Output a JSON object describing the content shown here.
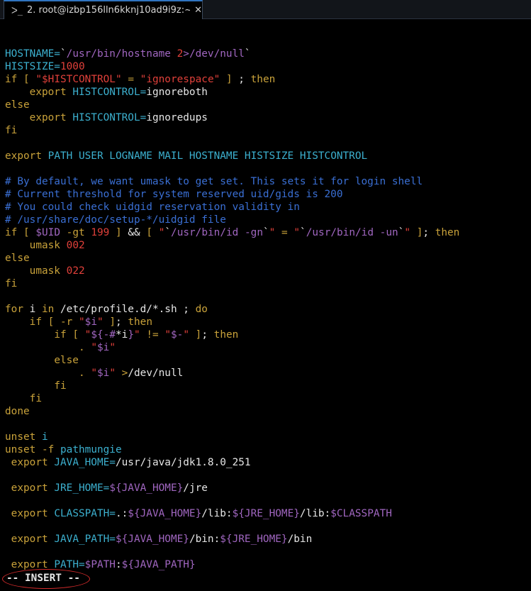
{
  "tab": {
    "icon": "terminal-icon",
    "icon_glyph": "ᐳ_",
    "title": "2. root@izbp156lln6kknj10ad9i9z:~",
    "close": "✕"
  },
  "lines": [
    [],
    [
      [
        "cy",
        "HOSTNAME="
      ],
      [
        "wh",
        "`"
      ],
      [
        "mg",
        "/usr/bin/hostname "
      ],
      [
        "rd",
        "2"
      ],
      [
        "mg",
        ">/dev/null"
      ],
      [
        "wh",
        "`"
      ]
    ],
    [
      [
        "cy",
        "HISTSIZE="
      ],
      [
        "rd",
        "1000"
      ]
    ],
    [
      [
        "ol",
        "if"
      ],
      [
        "wh",
        " "
      ],
      [
        "ol",
        "["
      ],
      [
        "wh",
        " "
      ],
      [
        "rd",
        "\"$HISTCONTROL\""
      ],
      [
        "wh",
        " "
      ],
      [
        "ol",
        "="
      ],
      [
        "wh",
        " "
      ],
      [
        "rd",
        "\"ignorespace\""
      ],
      [
        "wh",
        " "
      ],
      [
        "ol",
        "]"
      ],
      [
        "wh",
        " ; "
      ],
      [
        "ol",
        "then"
      ]
    ],
    [
      [
        "wh",
        "    "
      ],
      [
        "ol",
        "export"
      ],
      [
        "wh",
        " "
      ],
      [
        "cy",
        "HISTCONTROL="
      ],
      [
        "wh",
        "ignoreboth"
      ]
    ],
    [
      [
        "ol",
        "else"
      ]
    ],
    [
      [
        "wh",
        "    "
      ],
      [
        "ol",
        "export"
      ],
      [
        "wh",
        " "
      ],
      [
        "cy",
        "HISTCONTROL="
      ],
      [
        "wh",
        "ignoredups"
      ]
    ],
    [
      [
        "ol",
        "fi"
      ]
    ],
    [],
    [
      [
        "ol",
        "export"
      ],
      [
        "wh",
        " "
      ],
      [
        "cy",
        "PATH USER LOGNAME MAIL HOSTNAME HISTSIZE HISTCONTROL"
      ]
    ],
    [],
    [
      [
        "bl",
        "# By default, we want umask to get set. This sets it for login shell"
      ]
    ],
    [
      [
        "bl",
        "# Current threshold for system reserved uid/gids is 200"
      ]
    ],
    [
      [
        "bl",
        "# You could check uidgid reservation validity in"
      ]
    ],
    [
      [
        "bl",
        "# /usr/share/doc/setup-*/uidgid file"
      ]
    ],
    [
      [
        "ol",
        "if"
      ],
      [
        "wh",
        " "
      ],
      [
        "ol",
        "["
      ],
      [
        "wh",
        " "
      ],
      [
        "mg",
        "$UID"
      ],
      [
        "wh",
        " "
      ],
      [
        "ol",
        "-gt"
      ],
      [
        "wh",
        " "
      ],
      [
        "rd",
        "199"
      ],
      [
        "wh",
        " "
      ],
      [
        "ol",
        "]"
      ],
      [
        "wh",
        " && "
      ],
      [
        "ol",
        "["
      ],
      [
        "wh",
        " "
      ],
      [
        "rd",
        "\""
      ],
      [
        "wh",
        "`"
      ],
      [
        "mg",
        "/usr/bin/id -gn"
      ],
      [
        "wh",
        "`"
      ],
      [
        "rd",
        "\""
      ],
      [
        "wh",
        " "
      ],
      [
        "ol",
        "="
      ],
      [
        "wh",
        " "
      ],
      [
        "rd",
        "\""
      ],
      [
        "wh",
        "`"
      ],
      [
        "mg",
        "/usr/bin/id -un"
      ],
      [
        "wh",
        "`"
      ],
      [
        "rd",
        "\""
      ],
      [
        "wh",
        " "
      ],
      [
        "ol",
        "]"
      ],
      [
        "wh",
        "; "
      ],
      [
        "ol",
        "then"
      ]
    ],
    [
      [
        "wh",
        "    "
      ],
      [
        "ol",
        "umask"
      ],
      [
        "wh",
        " "
      ],
      [
        "rd",
        "002"
      ]
    ],
    [
      [
        "ol",
        "else"
      ]
    ],
    [
      [
        "wh",
        "    "
      ],
      [
        "ol",
        "umask"
      ],
      [
        "wh",
        " "
      ],
      [
        "rd",
        "022"
      ]
    ],
    [
      [
        "ol",
        "fi"
      ]
    ],
    [],
    [
      [
        "ol",
        "for"
      ],
      [
        "wh",
        " i "
      ],
      [
        "ol",
        "in"
      ],
      [
        "wh",
        " /etc/profile.d/*.sh ; "
      ],
      [
        "ol",
        "do"
      ]
    ],
    [
      [
        "wh",
        "    "
      ],
      [
        "ol",
        "if"
      ],
      [
        "wh",
        " "
      ],
      [
        "ol",
        "["
      ],
      [
        "wh",
        " "
      ],
      [
        "ol",
        "-r"
      ],
      [
        "wh",
        " "
      ],
      [
        "rd",
        "\""
      ],
      [
        "mg",
        "$i"
      ],
      [
        "rd",
        "\""
      ],
      [
        "wh",
        " "
      ],
      [
        "ol",
        "]"
      ],
      [
        "wh",
        "; "
      ],
      [
        "ol",
        "then"
      ]
    ],
    [
      [
        "wh",
        "        "
      ],
      [
        "ol",
        "if"
      ],
      [
        "wh",
        " "
      ],
      [
        "ol",
        "["
      ],
      [
        "wh",
        " "
      ],
      [
        "rd",
        "\""
      ],
      [
        "mg",
        "${-#"
      ],
      [
        "wh",
        "*i"
      ],
      [
        "mg",
        "}"
      ],
      [
        "rd",
        "\""
      ],
      [
        "wh",
        " "
      ],
      [
        "ol",
        "!="
      ],
      [
        "wh",
        " "
      ],
      [
        "rd",
        "\""
      ],
      [
        "mg",
        "$-"
      ],
      [
        "rd",
        "\""
      ],
      [
        "wh",
        " "
      ],
      [
        "ol",
        "]"
      ],
      [
        "wh",
        "; "
      ],
      [
        "ol",
        "then"
      ]
    ],
    [
      [
        "wh",
        "            "
      ],
      [
        "ol",
        "."
      ],
      [
        "wh",
        " "
      ],
      [
        "rd",
        "\""
      ],
      [
        "mg",
        "$i"
      ],
      [
        "rd",
        "\""
      ]
    ],
    [
      [
        "wh",
        "        "
      ],
      [
        "ol",
        "else"
      ]
    ],
    [
      [
        "wh",
        "            "
      ],
      [
        "ol",
        "."
      ],
      [
        "wh",
        " "
      ],
      [
        "rd",
        "\""
      ],
      [
        "mg",
        "$i"
      ],
      [
        "rd",
        "\""
      ],
      [
        "wh",
        " "
      ],
      [
        "ol",
        ">"
      ],
      [
        "wh",
        "/dev/null"
      ]
    ],
    [
      [
        "wh",
        "        "
      ],
      [
        "ol",
        "fi"
      ]
    ],
    [
      [
        "wh",
        "    "
      ],
      [
        "ol",
        "fi"
      ]
    ],
    [
      [
        "ol",
        "done"
      ]
    ],
    [],
    [
      [
        "ol",
        "unset"
      ],
      [
        "wh",
        " "
      ],
      [
        "cy",
        "i"
      ]
    ],
    [
      [
        "ol",
        "unset"
      ],
      [
        "wh",
        " "
      ],
      [
        "ol",
        "-f"
      ],
      [
        "wh",
        " "
      ],
      [
        "cy",
        "pathmungie"
      ]
    ],
    [
      [
        "wh",
        " "
      ],
      [
        "ol",
        "export"
      ],
      [
        "wh",
        " "
      ],
      [
        "cy",
        "JAVA_HOME="
      ],
      [
        "wh",
        "/usr/java/jdk1.8.0_251"
      ]
    ],
    [],
    [
      [
        "wh",
        " "
      ],
      [
        "ol",
        "export"
      ],
      [
        "wh",
        " "
      ],
      [
        "cy",
        "JRE_HOME="
      ],
      [
        "mg",
        "${JAVA_HOME}"
      ],
      [
        "wh",
        "/jre"
      ]
    ],
    [],
    [
      [
        "wh",
        " "
      ],
      [
        "ol",
        "export"
      ],
      [
        "wh",
        " "
      ],
      [
        "cy",
        "CLASSPATH="
      ],
      [
        "wh",
        ".:"
      ],
      [
        "mg",
        "${JAVA_HOME}"
      ],
      [
        "wh",
        "/lib:"
      ],
      [
        "mg",
        "${JRE_HOME}"
      ],
      [
        "wh",
        "/lib:"
      ],
      [
        "mg",
        "$CLASSPATH"
      ]
    ],
    [],
    [
      [
        "wh",
        " "
      ],
      [
        "ol",
        "export"
      ],
      [
        "wh",
        " "
      ],
      [
        "cy",
        "JAVA_PATH="
      ],
      [
        "mg",
        "${JAVA_HOME}"
      ],
      [
        "wh",
        "/bin:"
      ],
      [
        "mg",
        "${JRE_HOME}"
      ],
      [
        "wh",
        "/bin"
      ]
    ],
    [],
    [
      [
        "wh",
        " "
      ],
      [
        "ol",
        "export"
      ],
      [
        "wh",
        " "
      ],
      [
        "cy",
        "PATH="
      ],
      [
        "mg",
        "$PATH"
      ],
      [
        "wh",
        ":"
      ],
      [
        "mg",
        "${JAVA_PATH}"
      ]
    ]
  ],
  "status": {
    "mode": "-- INSERT --"
  },
  "colors": {
    "background": "#000000",
    "variable_cyan": "#3cb0cf",
    "string_red": "#e0403a",
    "expansion_magenta": "#a066c0",
    "keyword_olive": "#c9a23a",
    "comment_blue": "#3a6fd4",
    "highlight_ellipse": "#d22b2b"
  }
}
